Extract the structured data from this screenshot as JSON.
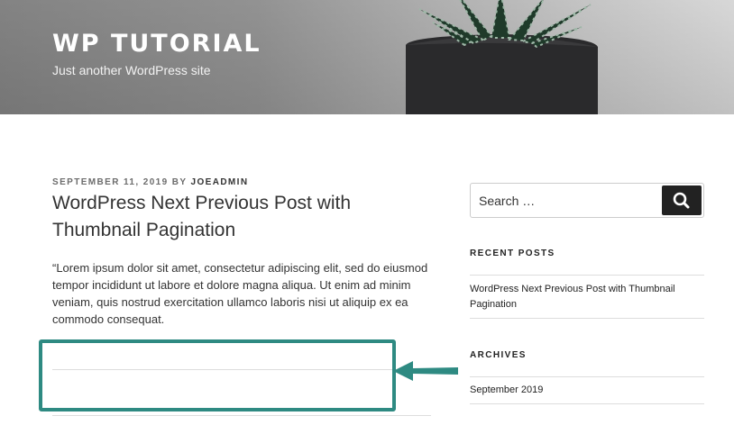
{
  "header": {
    "site_title": "WP TUTORIAL",
    "site_description": "Just another WordPress site"
  },
  "post": {
    "date": "SEPTEMBER 11, 2019",
    "by": "BY",
    "author": "JOEADMIN",
    "title": "WordPress Next Previous Post with Thumbnail Pagination",
    "excerpt": "“Lorem ipsum dolor sit amet, consectetur adipiscing elit, sed do eiusmod tempor incididunt ut labore et dolore magna aliqua. Ut enim ad minim veniam, quis nostrud exercitation ullamco laboris nisi ut aliquip ex ea commodo consequat."
  },
  "sidebar": {
    "search": {
      "placeholder": "Search …"
    },
    "recent_posts": {
      "title": "RECENT POSTS",
      "items": [
        {
          "label": "WordPress Next Previous Post with Thumbnail Pagination"
        }
      ]
    },
    "archives": {
      "title": "ARCHIVES",
      "items": [
        {
          "label": "September 2019"
        }
      ]
    }
  },
  "annotation": {
    "color": "#2e8a82"
  }
}
